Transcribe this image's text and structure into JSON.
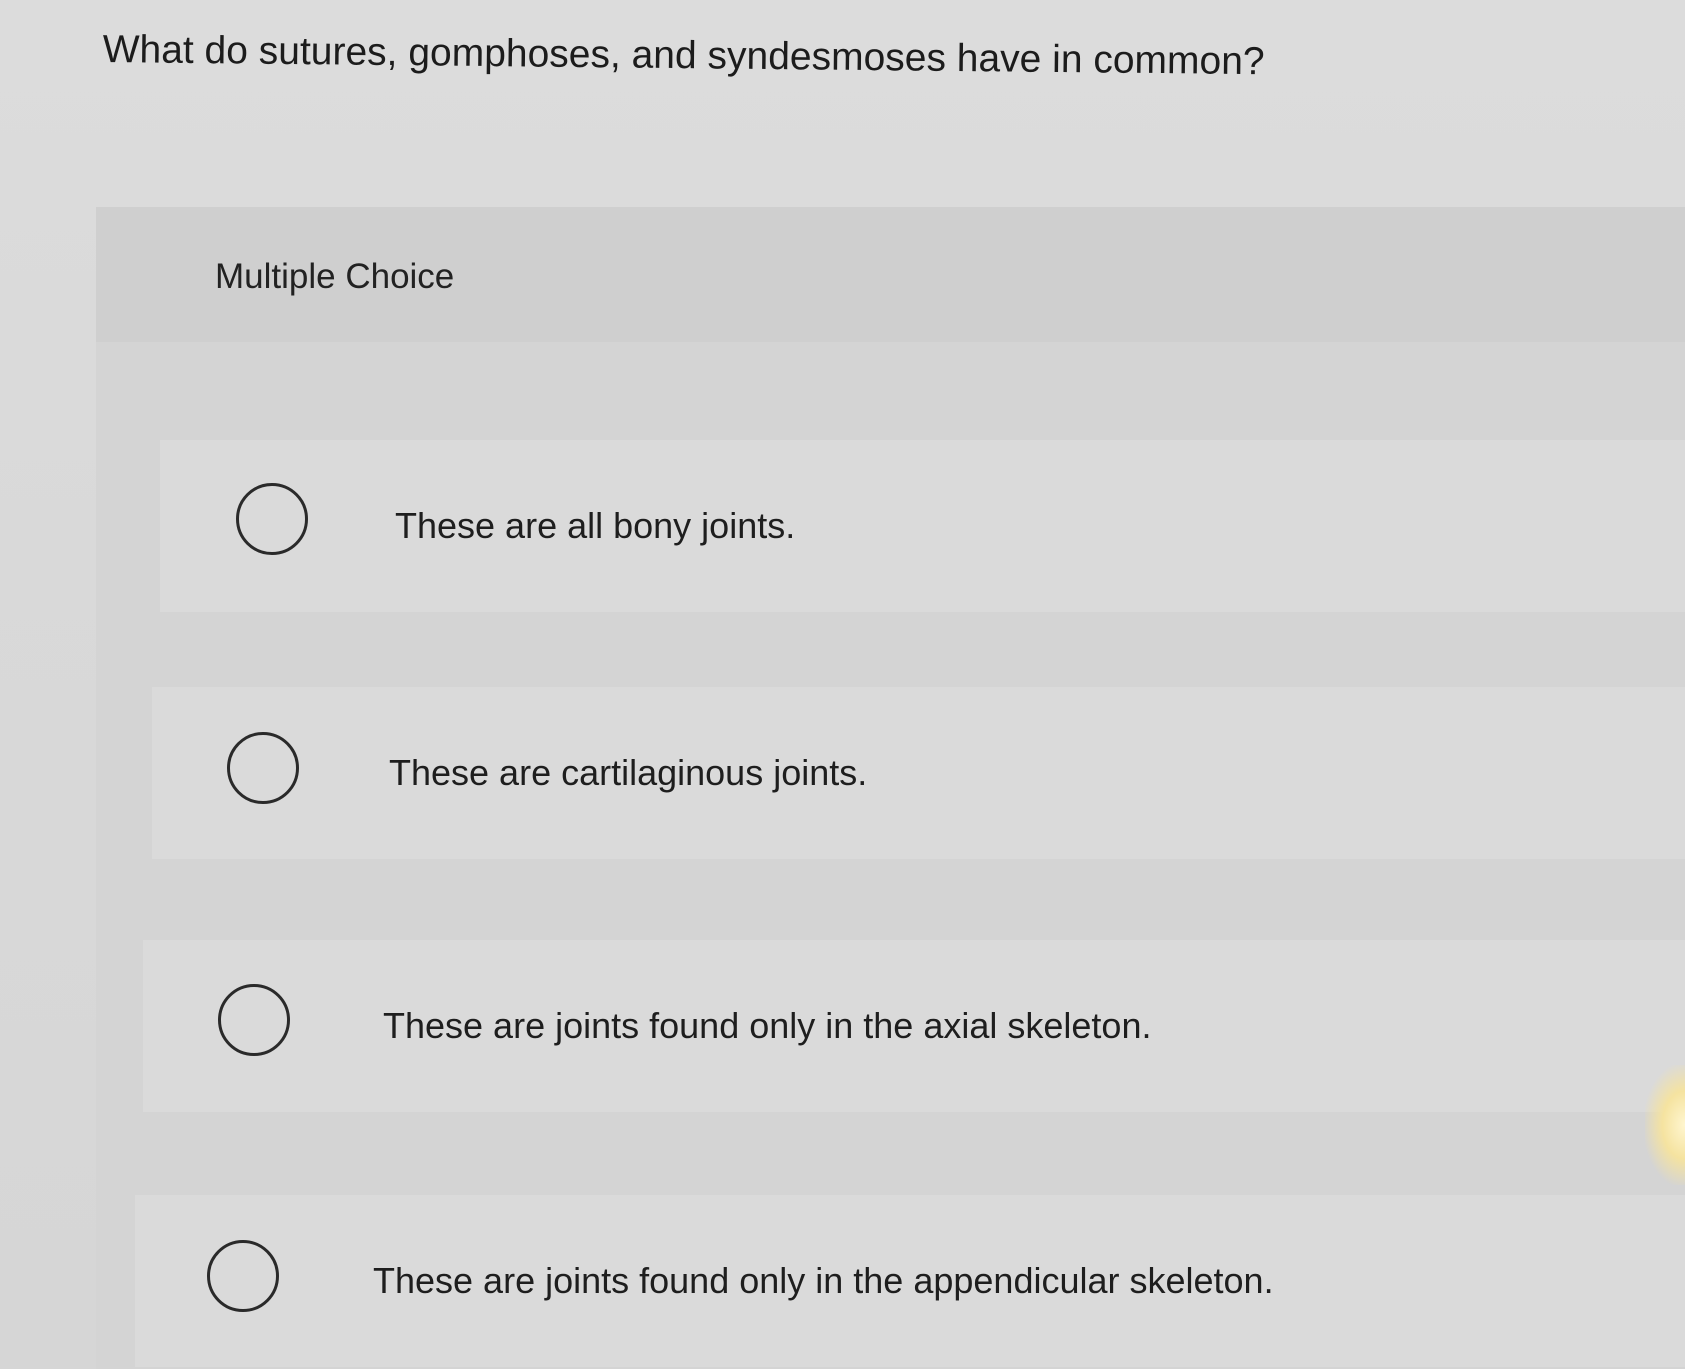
{
  "question": {
    "text": "What do sutures, gomphoses, and syndesmoses have in common?"
  },
  "panel": {
    "label": "Multiple Choice"
  },
  "options": [
    {
      "label": "These are all bony joints."
    },
    {
      "label": "These are cartilaginous joints."
    },
    {
      "label": "These are joints found only in the axial skeleton."
    },
    {
      "label": "These are joints found only in the appendicular skeleton."
    }
  ]
}
